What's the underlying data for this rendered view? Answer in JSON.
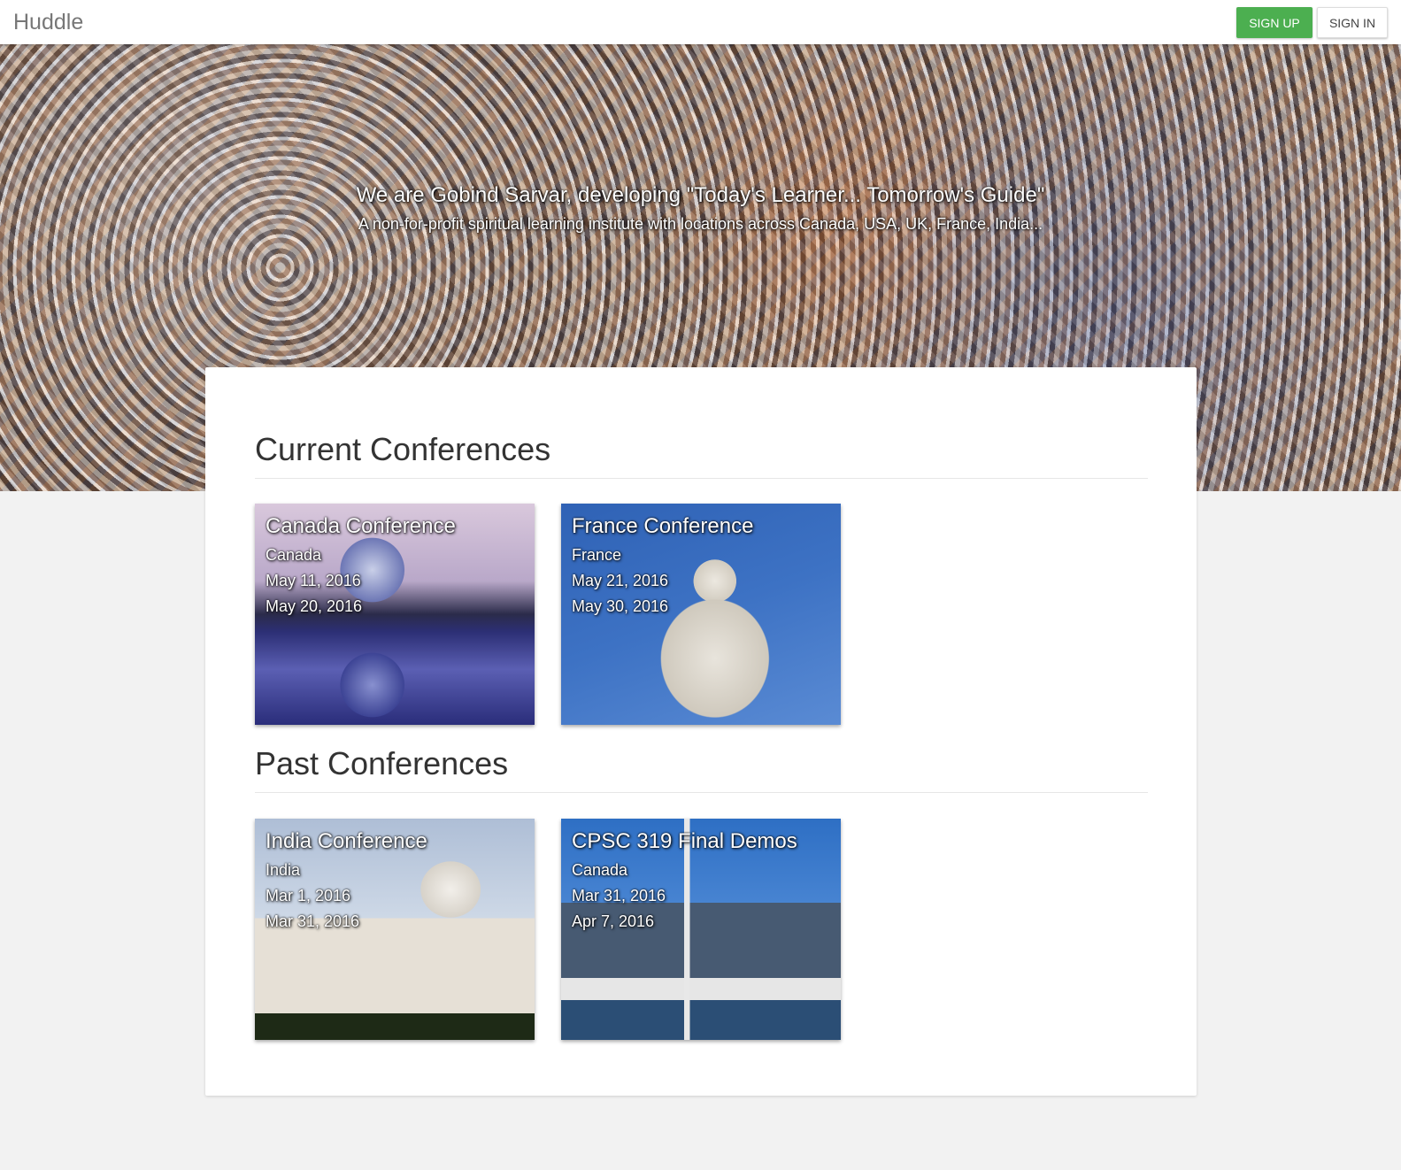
{
  "navbar": {
    "brand": "Huddle",
    "signup_label": "SIGN UP",
    "signin_label": "SIGN IN",
    "signup_color": "#4caf50"
  },
  "hero": {
    "title": "We are Gobind Sarvar, developing \"Today's Learner... Tomorrow's Guide\"",
    "subtitle": "A non-for-profit spiritual learning institute with locations across Canada, USA, UK, France, India..."
  },
  "current": {
    "heading": "Current Conferences",
    "items": [
      {
        "name": "Canada Conference",
        "location": "Canada",
        "start": "May 11, 2016",
        "end": "May 20, 2016",
        "image": "vancouver-science-world"
      },
      {
        "name": "France Conference",
        "location": "France",
        "start": "May 21, 2016",
        "end": "May 30, 2016",
        "image": "sacre-coeur-basilica"
      }
    ]
  },
  "past": {
    "heading": "Past Conferences",
    "items": [
      {
        "name": "India Conference",
        "location": "India",
        "start": "Mar 1, 2016",
        "end": "Mar 31, 2016",
        "image": "taj-mahal"
      },
      {
        "name": "CPSC 319 Final Demos",
        "location": "Canada",
        "start": "Mar 31, 2016",
        "end": "Apr 7, 2016",
        "image": "toronto-harbour"
      }
    ]
  }
}
